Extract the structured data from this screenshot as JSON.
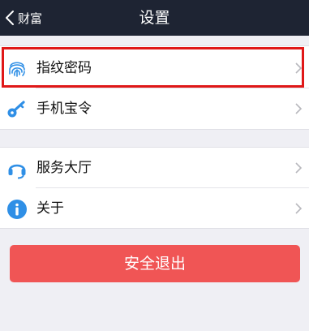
{
  "navbar": {
    "back_label": "财富",
    "title": "设置"
  },
  "settings": {
    "group1": [
      {
        "label": "指纹密码",
        "icon": "fingerprint-icon"
      },
      {
        "label": "手机宝令",
        "icon": "key-icon"
      }
    ],
    "group2": [
      {
        "label": "服务大厅",
        "icon": "headset-icon"
      },
      {
        "label": "关于",
        "icon": "info-icon"
      }
    ]
  },
  "logout": {
    "label": "安全退出"
  },
  "colors": {
    "navbar_bg": "#1e2433",
    "icon_blue": "#2f8fe6",
    "logout_bg": "#f05555",
    "highlight": "#e01818",
    "page_bg": "#efeff4"
  }
}
